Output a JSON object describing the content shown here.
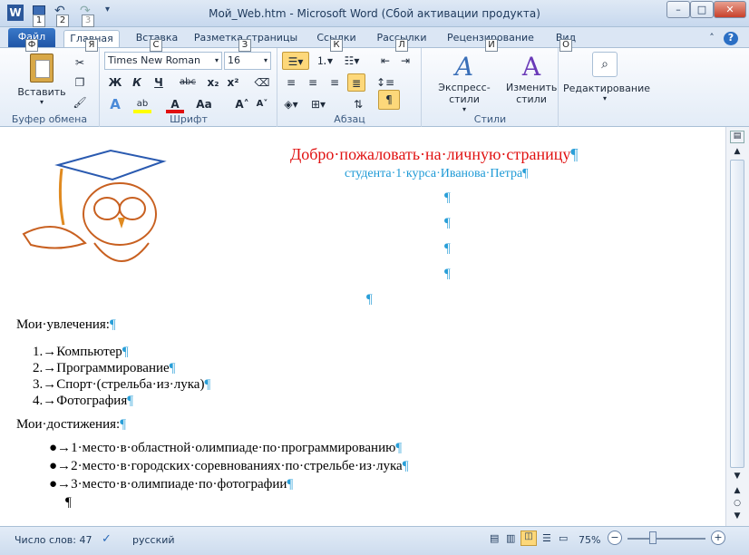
{
  "window": {
    "title": "Мой_Web.htm  -  Microsoft Word (Сбой активации продукта)",
    "app_icon": "W",
    "minimize": "–",
    "maximize": "□",
    "close": "✕"
  },
  "keytips": {
    "qat1": "1",
    "qat2": "2",
    "qat3": "3",
    "file": "Ф",
    "home": "Я",
    "insert": "С",
    "layout": "З",
    "refs": "К",
    "mail": "Л",
    "review": "И",
    "view": "О"
  },
  "tabs": {
    "file": "Файл",
    "home": "Главная",
    "insert": "Вставка",
    "layout": "Разметка страницы",
    "refs": "Ссылки",
    "mail": "Рассылки",
    "review": "Рецензирование",
    "view": "Вид"
  },
  "ribbon": {
    "clipboard": {
      "paste": "Вставить",
      "label": "Буфер обмена"
    },
    "font": {
      "name": "Times New Roman",
      "size": "16",
      "label": "Шрифт",
      "bold": "Ж",
      "italic": "К",
      "underline": "Ч",
      "strike": "abc",
      "sub": "x₂",
      "sup": "x²",
      "case": "Aa",
      "grow": "A˄",
      "shrink": "A˅",
      "font_color_sample": "A"
    },
    "paragraph": {
      "label": "Абзац",
      "pilcrow": "¶"
    },
    "styles": {
      "express": "Экспресс-стили",
      "change": "Изменить стили",
      "label": "Стили"
    },
    "editing": {
      "label": "Редактирование"
    }
  },
  "document": {
    "title": "Добро·пожаловать·на·личную·страницу",
    "subtitle": "студента·1·курса·Иванова·Петра",
    "pilcrow": "¶",
    "hobbies_heading": "Мои·увлечения:",
    "hobbies": [
      {
        "num": "1.→",
        "text": "Компьютер"
      },
      {
        "num": "2.→",
        "text": "Программирование"
      },
      {
        "num": "3.→",
        "text": "Спорт·(стрельба·из·лука)"
      },
      {
        "num": "4.→",
        "text": "Фотография"
      }
    ],
    "achievements_heading": "Мои·достижения:",
    "achievements": [
      "1·место·в·областной·олимпиаде·по·программированию",
      "2·место·в·городских·соревнованиях·по·стрельбе·из·лука",
      "3·место·в·олимпиаде·по·фотографии"
    ],
    "bullet": "●→"
  },
  "status": {
    "word_count": "Число слов: 47",
    "language": "русский",
    "zoom": "75%",
    "zoom_minus": "−",
    "zoom_plus": "+"
  },
  "colors": {
    "title_red": "#e01010",
    "subtitle_blue": "#1e9ad6",
    "accent": "#2b579a"
  }
}
